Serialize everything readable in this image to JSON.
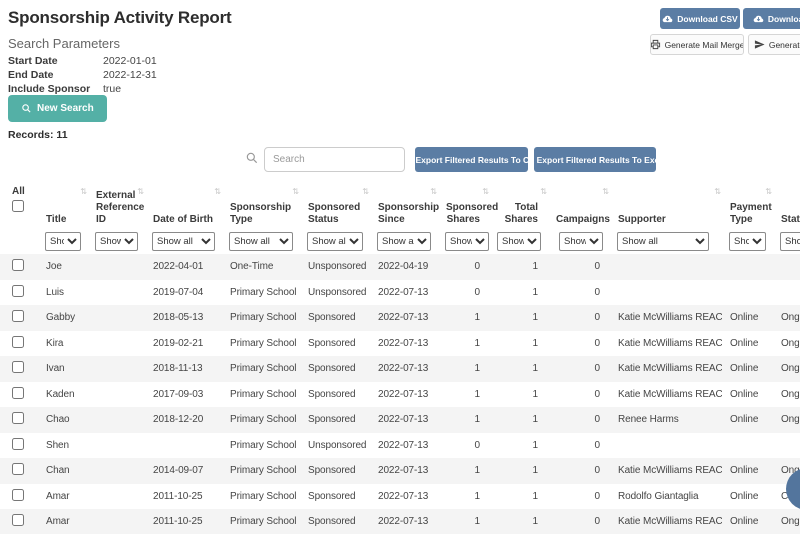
{
  "page_title": "Sponsorship Activity Report",
  "top_actions": {
    "download_csv": "Download CSV",
    "download_excel": "Download Excel",
    "generate_mail_merge": "Generate Mail Merge",
    "generate_emails": "Generate Emails"
  },
  "search_parameters": {
    "heading": "Search Parameters",
    "fields": [
      {
        "label": "Start Date",
        "value": "2022-01-01"
      },
      {
        "label": "End Date",
        "value": "2022-12-31"
      },
      {
        "label": "Include Sponsor Details",
        "value": "true"
      }
    ],
    "new_search_label": "New Search"
  },
  "records_label": "Records: 11",
  "toolbar": {
    "search_placeholder": "Search",
    "export_csv": "Export Filtered Results To CSV",
    "export_excel": "Export Filtered Results To Excel"
  },
  "table": {
    "select_all_label": "All",
    "filter_default": "Show all",
    "columns": [
      {
        "key": "title",
        "label": "Title"
      },
      {
        "key": "external_reference_id",
        "label": "External Reference ID"
      },
      {
        "key": "date_of_birth",
        "label": "Date of Birth"
      },
      {
        "key": "sponsorship_type",
        "label": "Sponsorship Type"
      },
      {
        "key": "sponsored_status",
        "label": "Sponsored Status"
      },
      {
        "key": "sponsorship_since",
        "label": "Sponsorship Since"
      },
      {
        "key": "sponsored_shares",
        "label": "Sponsored Shares",
        "numeric": true
      },
      {
        "key": "total_shares",
        "label": "Total Shares",
        "numeric": true
      },
      {
        "key": "campaigns",
        "label": "Campaigns",
        "numeric": true
      },
      {
        "key": "supporter",
        "label": "Supporter"
      },
      {
        "key": "payment_type",
        "label": "Payment Type"
      },
      {
        "key": "status",
        "label": "Status"
      }
    ],
    "rows": [
      {
        "title": "Joe",
        "external_reference_id": "",
        "date_of_birth": "2022-04-01",
        "sponsorship_type": "One-Time",
        "sponsored_status": "Unsponsored",
        "sponsorship_since": "2022-04-19",
        "sponsored_shares": 0,
        "total_shares": 1,
        "campaigns": 0,
        "supporter": "",
        "payment_type": "",
        "status": ""
      },
      {
        "title": "Luis",
        "external_reference_id": "",
        "date_of_birth": "2019-07-04",
        "sponsorship_type": "Primary School",
        "sponsored_status": "Unsponsored",
        "sponsorship_since": "2022-07-13",
        "sponsored_shares": 0,
        "total_shares": 1,
        "campaigns": 0,
        "supporter": "",
        "payment_type": "",
        "status": ""
      },
      {
        "title": "Gabby",
        "external_reference_id": "",
        "date_of_birth": "2018-05-13",
        "sponsorship_type": "Primary School",
        "sponsored_status": "Sponsored",
        "sponsorship_since": "2022-07-13",
        "sponsored_shares": 1,
        "total_shares": 1,
        "campaigns": 0,
        "supporter": "Katie McWilliams REACH",
        "payment_type": "Online",
        "status": "Ongoing"
      },
      {
        "title": "Kira",
        "external_reference_id": "",
        "date_of_birth": "2019-02-21",
        "sponsorship_type": "Primary School",
        "sponsored_status": "Sponsored",
        "sponsorship_since": "2022-07-13",
        "sponsored_shares": 1,
        "total_shares": 1,
        "campaigns": 0,
        "supporter": "Katie McWilliams REACH",
        "payment_type": "Online",
        "status": "Ongoing"
      },
      {
        "title": "Ivan",
        "external_reference_id": "",
        "date_of_birth": "2018-11-13",
        "sponsorship_type": "Primary School",
        "sponsored_status": "Sponsored",
        "sponsorship_since": "2022-07-13",
        "sponsored_shares": 1,
        "total_shares": 1,
        "campaigns": 0,
        "supporter": "Katie McWilliams REACH",
        "payment_type": "Online",
        "status": "Ongoing"
      },
      {
        "title": "Kaden",
        "external_reference_id": "",
        "date_of_birth": "2017-09-03",
        "sponsorship_type": "Primary School",
        "sponsored_status": "Sponsored",
        "sponsorship_since": "2022-07-13",
        "sponsored_shares": 1,
        "total_shares": 1,
        "campaigns": 0,
        "supporter": "Katie McWilliams REACH",
        "payment_type": "Online",
        "status": "Ongoing"
      },
      {
        "title": "Chao",
        "external_reference_id": "",
        "date_of_birth": "2018-12-20",
        "sponsorship_type": "Primary School",
        "sponsored_status": "Sponsored",
        "sponsorship_since": "2022-07-13",
        "sponsored_shares": 1,
        "total_shares": 1,
        "campaigns": 0,
        "supporter": "Renee Harms",
        "payment_type": "Online",
        "status": "Ongoing"
      },
      {
        "title": "Shen",
        "external_reference_id": "",
        "date_of_birth": "",
        "sponsorship_type": "Primary School",
        "sponsored_status": "Unsponsored",
        "sponsorship_since": "2022-07-13",
        "sponsored_shares": 0,
        "total_shares": 1,
        "campaigns": 0,
        "supporter": "",
        "payment_type": "",
        "status": ""
      },
      {
        "title": "Chan",
        "external_reference_id": "",
        "date_of_birth": "2014-09-07",
        "sponsorship_type": "Primary School",
        "sponsored_status": "Sponsored",
        "sponsorship_since": "2022-07-13",
        "sponsored_shares": 1,
        "total_shares": 1,
        "campaigns": 0,
        "supporter": "Katie McWilliams REACH",
        "payment_type": "Online",
        "status": "Ongoing"
      },
      {
        "title": "Amar",
        "external_reference_id": "",
        "date_of_birth": "2011-10-25",
        "sponsorship_type": "Primary School",
        "sponsored_status": "Sponsored",
        "sponsorship_since": "2022-07-13",
        "sponsored_shares": 1,
        "total_shares": 1,
        "campaigns": 0,
        "supporter": "Rodolfo Giantaglia",
        "payment_type": "Online",
        "status": "Cancelled"
      },
      {
        "title": "Amar",
        "external_reference_id": "",
        "date_of_birth": "2011-10-25",
        "sponsorship_type": "Primary School",
        "sponsored_status": "Sponsored",
        "sponsorship_since": "2022-07-13",
        "sponsored_shares": 1,
        "total_shares": 1,
        "campaigns": 0,
        "supporter": "Katie McWilliams REACH",
        "payment_type": "Online",
        "status": "Ongoing"
      }
    ]
  },
  "colors": {
    "accent_blue": "#5b7da4",
    "teal": "#54b0a6",
    "stripe": "#f4f4f4"
  }
}
